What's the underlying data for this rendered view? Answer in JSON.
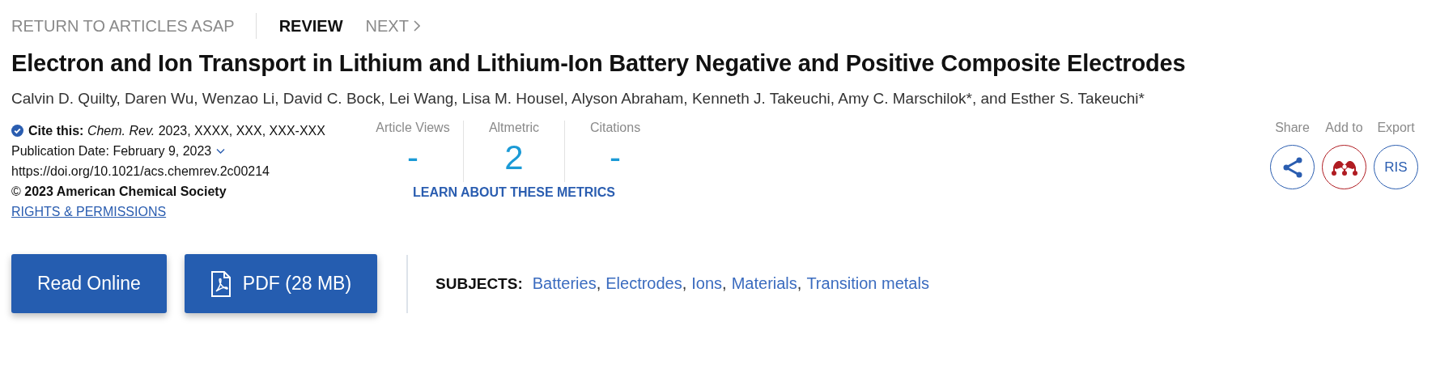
{
  "nav": {
    "back": "RETURN TO ARTICLES ASAP",
    "items": [
      {
        "label": "REVIEW",
        "selected": true,
        "kind": "section"
      },
      {
        "label": "NEXT",
        "selected": false,
        "kind": "next"
      }
    ]
  },
  "title": "Electron and Ion Transport in Lithium and Lithium-Ion Battery Negative and Positive Composite Electrodes",
  "authors": "Calvin D. Quilty, Daren Wu, Wenzao Li, David C. Bock, Lei Wang, Lisa M. Housel, Alyson Abraham, Kenneth J. Takeuchi, Amy C. Marschilok*, and Esther S. Takeuchi*",
  "citation": {
    "cite": "**Cite this:** *Chem. Rev.*  2023, XXXX, XXX, XXX-XXX",
    "publication_date": "Publication Date: February 9, 2023",
    "doi": "https://doi.org/10.1021/acs.chemrev.2c00214",
    "copyright": "© **2023 American Chemical Society**",
    "rights_link": "RIGHTS & PERMISSIONS"
  },
  "metrics": {
    "items": [
      {
        "label": "Article Views",
        "value": "-"
      },
      {
        "label": "Altmetric",
        "value": "2"
      },
      {
        "label": "Citations",
        "value": "-"
      }
    ],
    "link": "LEARN ABOUT THESE METRICS"
  },
  "actions": [
    {
      "label": "Share",
      "kind": "share"
    },
    {
      "label": "Add to",
      "kind": "mendeley"
    },
    {
      "label": "Export",
      "kind": "ris",
      "text": "RIS"
    }
  ],
  "buttons": [
    {
      "label": "Read Online",
      "kind": "read"
    },
    {
      "label": "PDF (28 MB)",
      "kind": "pdf"
    }
  ],
  "subjects": {
    "heading": "SUBJECTS:",
    "separator": ",",
    "items": [
      "Batteries",
      "Electrodes",
      "Ions",
      "Materials",
      "Transition metals"
    ]
  }
}
